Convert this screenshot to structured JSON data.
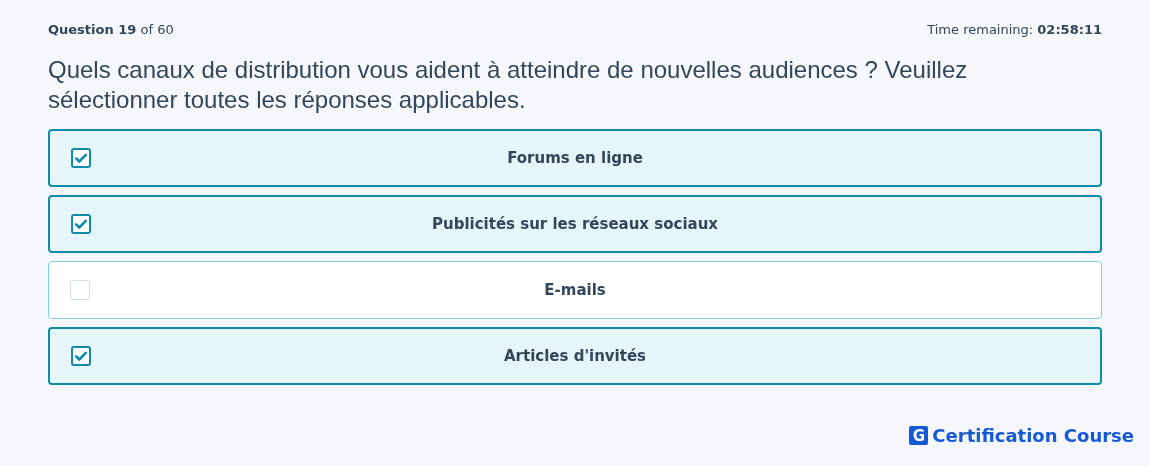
{
  "header": {
    "progress": "**Question 19** of 60",
    "timer_label": "Time remaining:",
    "timer_value": "02:58:11"
  },
  "question": "Quels canaux de distribution vous aident à atteindre de nouvelles audiences ? Veuillez sélectionner toutes les réponses applicables.",
  "options": [
    {
      "label": "Forums en ligne",
      "checked": true
    },
    {
      "label": "Publicités sur les réseaux sociaux",
      "checked": true
    },
    {
      "label": "E-mails",
      "checked": false
    },
    {
      "label": "Articles d'invités",
      "checked": true
    }
  ],
  "logo": {
    "mark": "G",
    "name": "Certification Course"
  }
}
